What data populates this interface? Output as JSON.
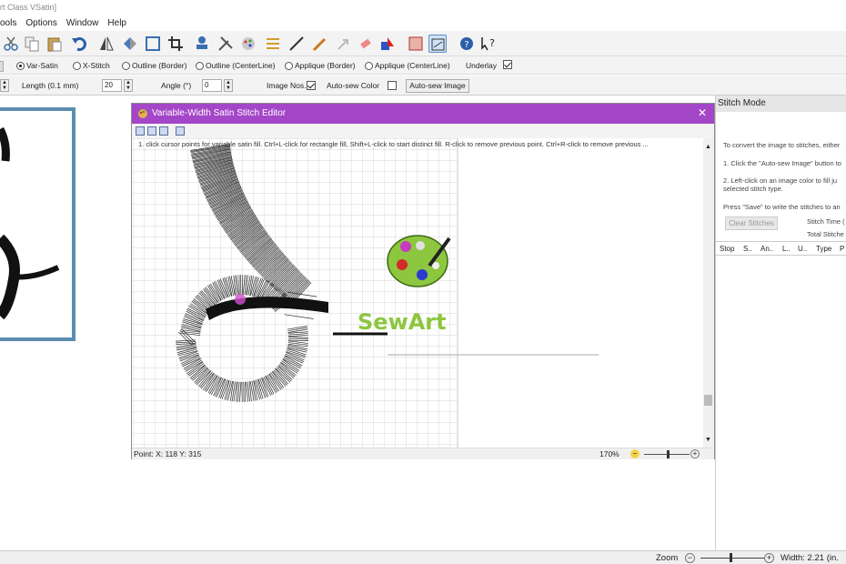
{
  "window": {
    "title": "rt Class VSatin]"
  },
  "menu": {
    "items": [
      "ools",
      "Options",
      "Window",
      "Help"
    ]
  },
  "modes": {
    "options": [
      "Var-Satin",
      "X-Stitch",
      "Outline (Border)",
      "Outline (CenterLine)",
      "Applique (Border)",
      "Applique (CenterLine)"
    ],
    "selected": "Var-Satin",
    "underlay_label": "Underlay",
    "underlay_checked": true
  },
  "params": {
    "length_label": "Length (0.1 mm)",
    "length_value": "20",
    "angle_label": "Angle (°)",
    "angle_value": "0",
    "image_nos_label": "Image Nos.",
    "image_nos_checked": true,
    "autosew_color_label": "Auto-sew Color",
    "autosew_color_checked": false,
    "autosew_button": "Auto-sew Image"
  },
  "editor": {
    "title": "Variable-Width Satin Stitch Editor",
    "close": "✕",
    "instructions": "1. click cursor points for variable satin fill. Ctrl+L-click for rectangle fill, Shift+L-click to start distinct fill. R-click to remove previous point. Ctrl+R-click to remove previous ...",
    "status_point": "Point: X: 118 Y: 315",
    "zoom": "170%",
    "logo_text": "SewArt"
  },
  "right_panel": {
    "title": "Stitch Mode",
    "lines": [
      "To convert the image to stitches, either",
      "1. Click the \"Auto-sew Image\" button to",
      "2. Left-click on an image color to fill ju",
      "selected stitch type.",
      "Press \"Save\" to write the stitches to an"
    ],
    "clear_button": "Clear Stitches",
    "stitch_time_label": "Stitch Time (",
    "total_stitches_label": "Total Stitche",
    "columns": [
      "Stop",
      "S..",
      "An..",
      "L..",
      "U..",
      "Type",
      "P"
    ]
  },
  "statusbar": {
    "zoom_label": "Zoom",
    "width_text": "Width: 2.21 (in."
  },
  "colors": {
    "editor_title": "#a446c8",
    "frame_blue": "#5b8db0",
    "logo_green": "#8dc63f"
  }
}
